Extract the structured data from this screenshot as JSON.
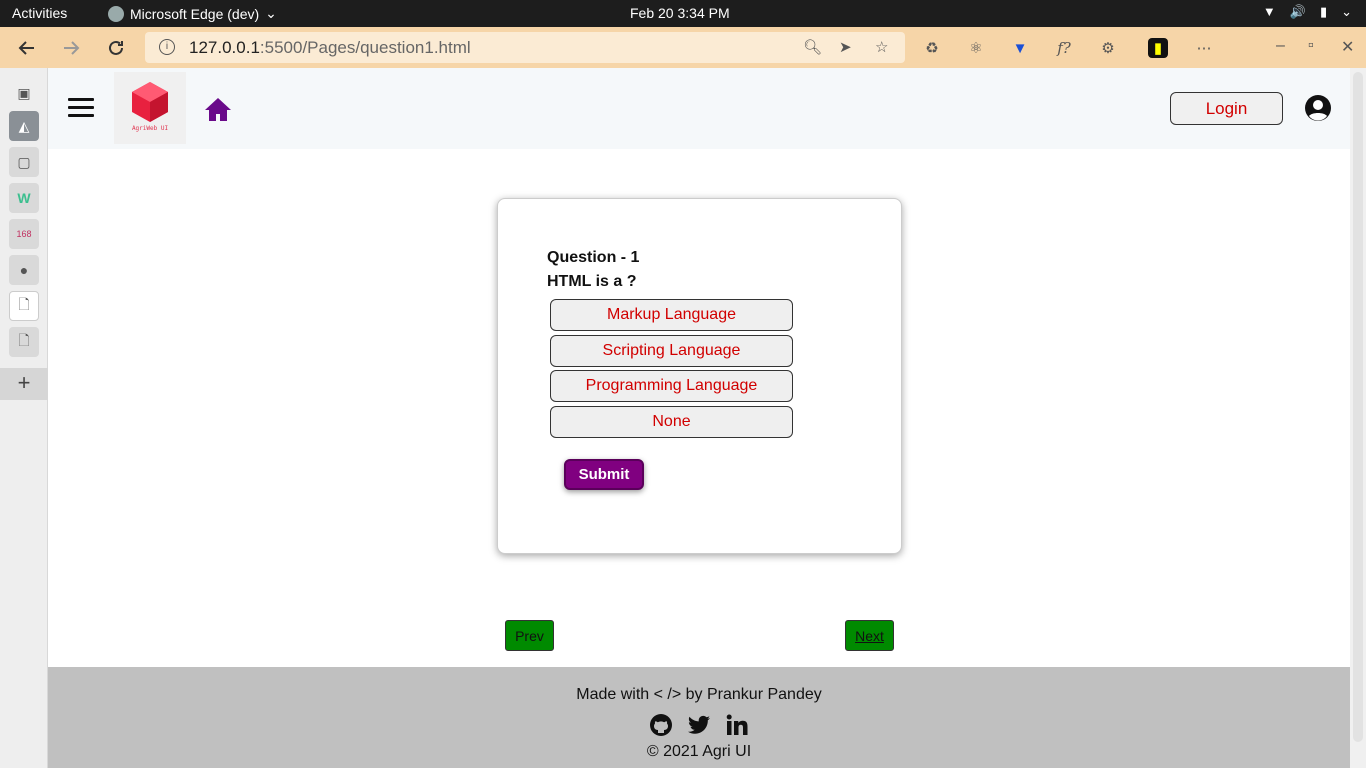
{
  "os": {
    "activities": "Activities",
    "app_name": "Microsoft Edge (dev)",
    "datetime": "Feb 20  3:34 PM"
  },
  "browser": {
    "url_host": "127.0.0.1",
    "url_rest": ":5500/Pages/question1.html"
  },
  "header": {
    "logo_text": "AgriWeb UI",
    "login_label": "Login"
  },
  "quiz": {
    "question_number": "Question - 1",
    "question_text": "HTML is a ?",
    "options": [
      "Markup Language",
      "Scripting Language",
      "Programming Language",
      "None"
    ],
    "submit_label": "Submit"
  },
  "pager": {
    "prev_label": "Prev",
    "next_label": "Next"
  },
  "footer": {
    "made_with": "Made with < /> by Prankur Pandey",
    "copyright": "© 2021 Agri UI",
    "social_icons": [
      "github-icon",
      "twitter-icon",
      "linkedin-icon"
    ]
  },
  "colors": {
    "accent_purple": "#800080",
    "option_text_red": "#d10000",
    "pager_green": "#008a00",
    "browser_toolbar": "#f6d5a8",
    "footer_gray": "#c0c0c0"
  }
}
